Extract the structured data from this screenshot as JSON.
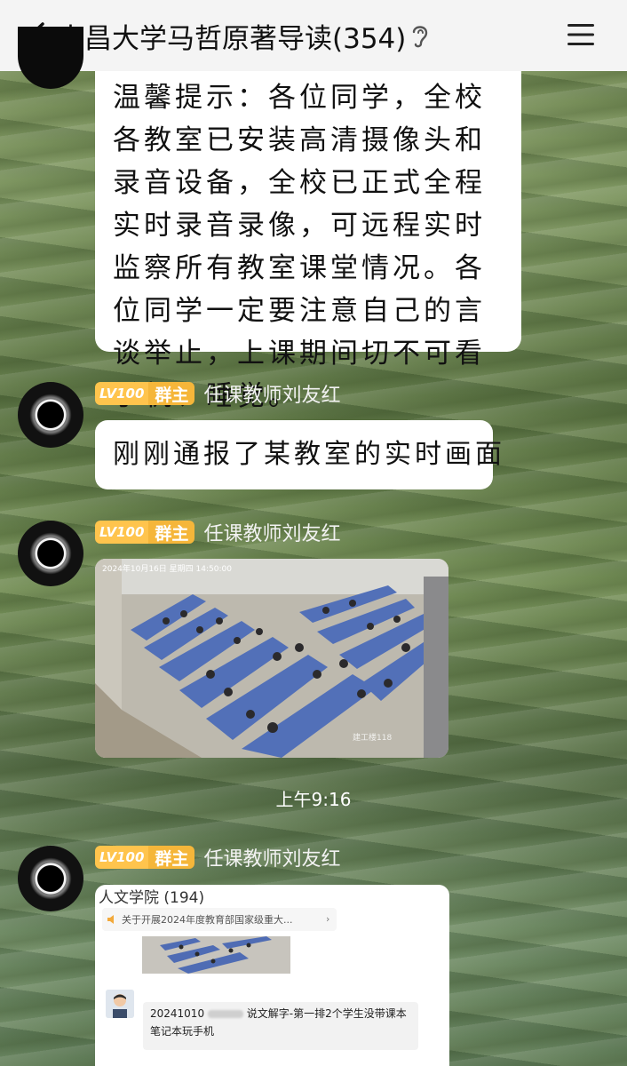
{
  "header": {
    "title": "南昌大学马哲原著导读(354)",
    "back_icon": "chevron-left-icon",
    "ear_icon": "ear-icon",
    "menu_icon": "hamburger-menu-icon"
  },
  "messages": [
    {
      "type": "text",
      "text": "温馨提示：各位同学，全校各教室已安装高清摄像头和录音设备，全校已正式全程实时录音录像，可远程实时监察所有教室课堂情况。各位同学一定要注意自己的言谈举止，上课期间切不可看手机、睡觉。"
    },
    {
      "type": "text",
      "level": "LV100",
      "role": "群主",
      "sender": "任课教师刘友红",
      "text": "刚刚通报了某教室的实时画面"
    },
    {
      "type": "image",
      "level": "LV100",
      "role": "群主",
      "sender": "任课教师刘友红",
      "caption": "2024年10月16日 星期四 14:50:00",
      "watermark": "建工楼118"
    },
    {
      "type": "image",
      "level": "LV100",
      "role": "群主",
      "sender": "任课教师刘友红",
      "card": {
        "title": "人文学院 (194)",
        "notice": "关于开展2024年度教育部国家级重大...",
        "message_prefix": "20241010",
        "message_text": "说文解字-第一排2个学生没带课本笔记本玩手机"
      }
    }
  ],
  "time_divider": "上午9:16",
  "colors": {
    "badge_level": "#ffc44d",
    "badge_owner": "#f5b63a",
    "header_bg": "#f4f4f4"
  }
}
